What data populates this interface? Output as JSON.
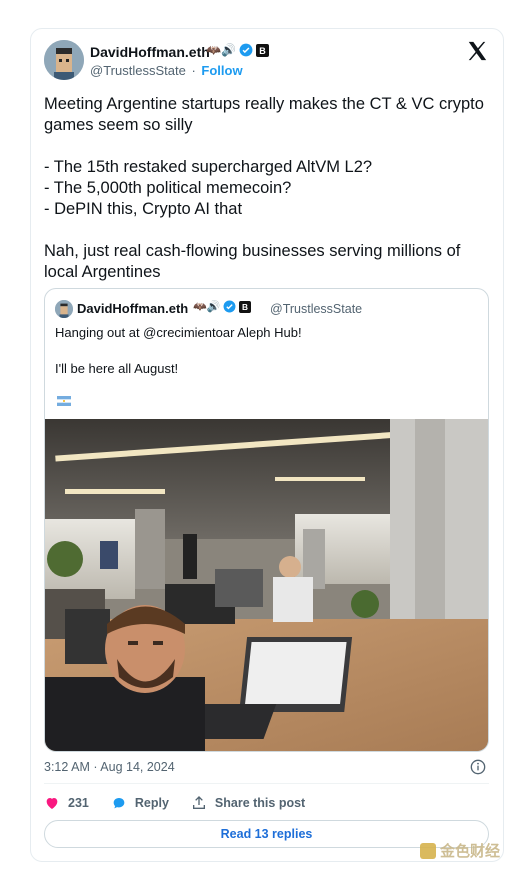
{
  "author": {
    "display_name": "DavidHoffman.eth",
    "name_emoji": "🦇🔊",
    "handle": "@TrustlessState",
    "separator": "·",
    "follow_label": "Follow"
  },
  "tweet": {
    "text": "Meeting Argentine startups really makes the CT & VC crypto games seem so silly\n\n- The 15th restaked supercharged AltVM L2?\n- The 5,000th political memecoin?\n- DePIN this, Crypto AI that\n\nNah, just real cash-flowing businesses serving millions of local Argentines",
    "timestamp": "3:12 AM · Aug 14, 2024"
  },
  "quoted": {
    "display_name": "DavidHoffman.eth",
    "name_emoji": "🦇🔊",
    "handle": "@TrustlessState",
    "text": "Hanging out at @crecimientoar Aleph Hub!\n\nI'll be here all August!"
  },
  "actions": {
    "likes_count": "231",
    "reply_label": "Reply",
    "share_label": "Share this post"
  },
  "read_replies_label": "Read 13 replies",
  "watermark_text": "金色财经",
  "colors": {
    "accent": "#1d9bf0",
    "heart": "#f91880",
    "text_secondary": "#536471",
    "verified": "#1d9bf0"
  }
}
